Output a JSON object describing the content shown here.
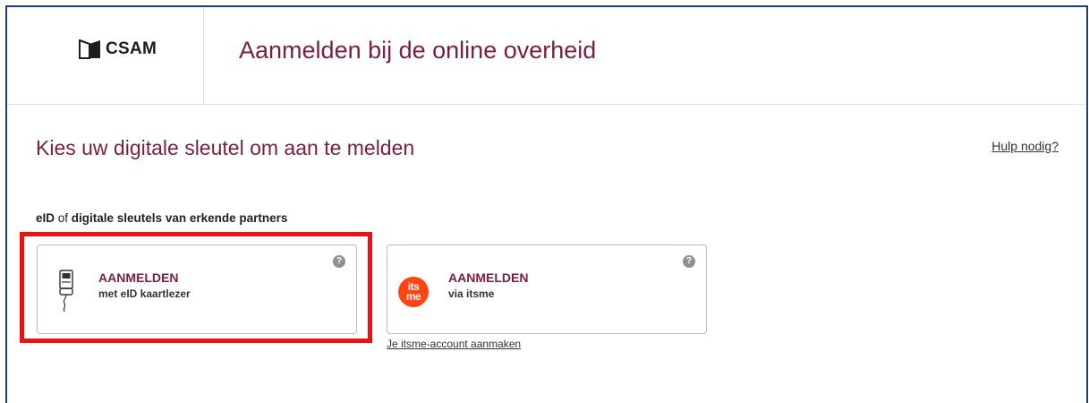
{
  "header": {
    "logo_text": "CSAM",
    "title": "Aanmelden bij de online overheid"
  },
  "main": {
    "subtitle": "Kies uw digitale sleutel om aan te melden",
    "help_link": "Hulp nodig?",
    "section_label": {
      "part1": "eID",
      "part2": " of ",
      "part3": "digitale sleutels van erkende partners"
    },
    "cards": [
      {
        "title": "AANMELDEN",
        "subtitle": "met eID kaartlezer",
        "icon": "card-reader-icon",
        "help": "?"
      },
      {
        "title": "AANMELDEN",
        "subtitle": "via itsme",
        "icon": "itsme-logo-icon",
        "icon_text_top": "its",
        "icon_text_bottom": "me",
        "help": "?"
      }
    ],
    "create_account_link": "Je itsme-account aanmaken"
  },
  "colors": {
    "brand": "#7a1f3f",
    "highlight": "#ee1111",
    "itsme": "#ff4612",
    "frame": "#1f3d7a"
  }
}
